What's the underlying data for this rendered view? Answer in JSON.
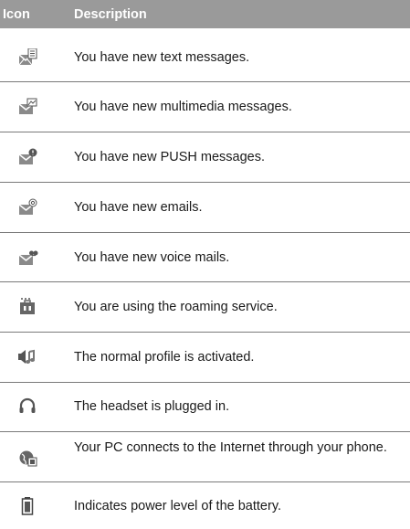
{
  "table": {
    "headers": {
      "icon": "Icon",
      "description": "Description"
    },
    "rows": [
      {
        "icon": "text-message-icon",
        "description": "You have new text messages."
      },
      {
        "icon": "multimedia-message-icon",
        "description": "You have new multimedia messages."
      },
      {
        "icon": "push-message-icon",
        "description": "You have new PUSH messages."
      },
      {
        "icon": "email-icon",
        "description": "You have new emails."
      },
      {
        "icon": "voicemail-icon",
        "description": "You have new voice mails."
      },
      {
        "icon": "roaming-icon",
        "description": "You are using the roaming service."
      },
      {
        "icon": "normal-profile-icon",
        "description": "The normal profile is activated."
      },
      {
        "icon": "headset-icon",
        "description": "The headset is plugged in."
      },
      {
        "icon": "internet-connect-icon",
        "description": "Your PC connects to the Internet through your phone."
      },
      {
        "icon": "battery-icon",
        "description": "Indicates power level of the battery."
      }
    ]
  }
}
